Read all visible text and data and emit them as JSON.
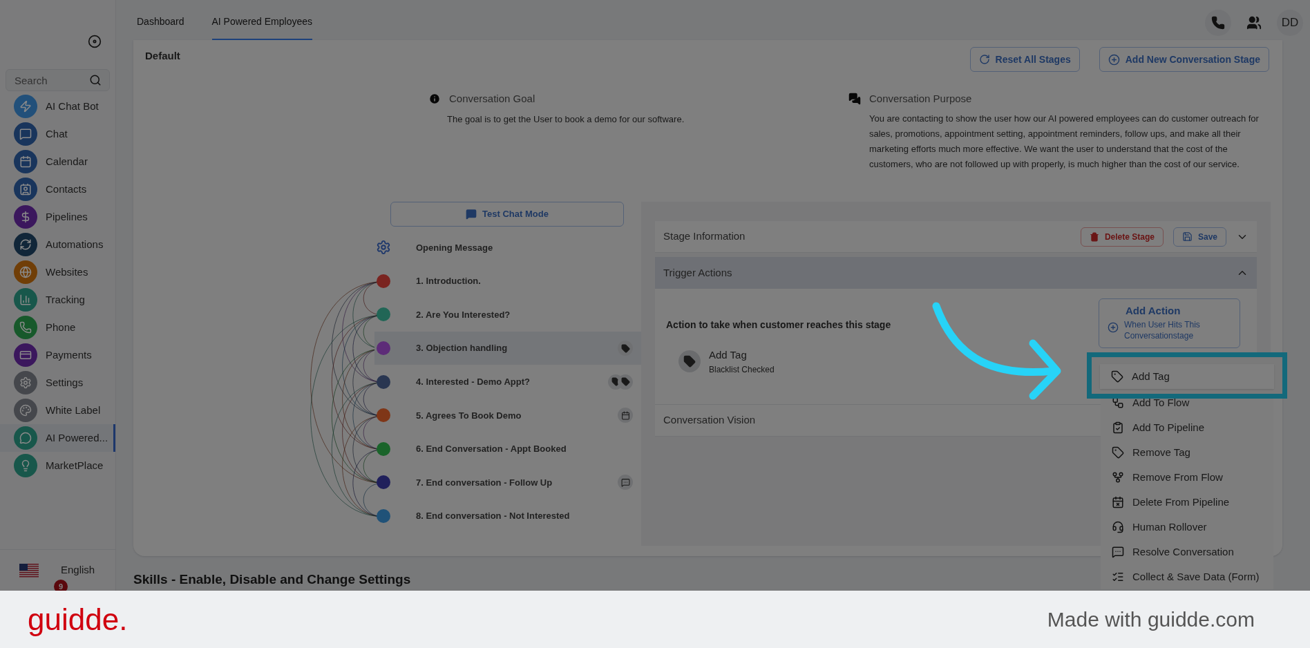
{
  "sidebar": {
    "search": {
      "placeholder": "Search"
    },
    "items": [
      {
        "label": "AI Chat Bot",
        "color": "#22507a",
        "selected": false
      },
      {
        "label": "Chat",
        "color": "#19355c",
        "selected": false
      },
      {
        "label": "Calendar",
        "color": "#19355c",
        "selected": false
      },
      {
        "label": "Contacts",
        "color": "#19355c",
        "selected": false
      },
      {
        "label": "Pipelines",
        "color": "#3b175d",
        "selected": false
      },
      {
        "label": "Automations",
        "color": "#112639",
        "selected": false
      },
      {
        "label": "Websites",
        "color": "#703e07",
        "selected": false
      },
      {
        "label": "Tracking",
        "color": "#18574b",
        "selected": false
      },
      {
        "label": "Phone",
        "color": "#17592b",
        "selected": false
      },
      {
        "label": "Payments",
        "color": "#3b175d",
        "selected": false
      },
      {
        "label": "Settings",
        "color": "#45474c",
        "selected": false
      },
      {
        "label": "White Label",
        "color": "#45474c",
        "selected": false
      },
      {
        "label": "AI Powered...",
        "color": "#18574b",
        "selected": true
      },
      {
        "label": "MarketPlace",
        "color": "#18574b",
        "selected": false
      }
    ],
    "language": "English",
    "badge": "9"
  },
  "tabs": [
    {
      "label": "Dashboard",
      "selected": false
    },
    {
      "label": "AI Powered Employees",
      "selected": true
    }
  ],
  "avatar": "DD",
  "card": {
    "title": "Default",
    "buttons": [
      "Reset All Stages",
      "Add New Conversation Stage"
    ],
    "goal": {
      "heading": "Conversation Goal",
      "text": "The goal is to get the User to book a demo for our software."
    },
    "purpose": {
      "heading": "Conversation Purpose",
      "text": "You are contacting to show the user how our AI powered employees can do customer outreach for sales, promotions, appointment setting, appointment reminders, follow ups, and make all their marketing efforts much more effective. We want the user to understand that the cost of the customers, who are not followed up with properly, is much higher than the cost of our service."
    },
    "test_button": "Test Chat Mode",
    "opening": "Opening Message",
    "stages": [
      {
        "label": "1. Introduction.",
        "color": "#7a2420",
        "selected": false
      },
      {
        "label": "2. Are You Interested?",
        "color": "#216656",
        "selected": false
      },
      {
        "label": "3. Objection handling",
        "color": "#5d2c78",
        "selected": true,
        "badges": [
          {
            "kind": "tag"
          }
        ]
      },
      {
        "label": "4. Interested - Demo Appt?",
        "color": "#293651",
        "selected": false,
        "badges": [
          {
            "kind": "tag"
          },
          {
            "kind": "tag"
          }
        ]
      },
      {
        "label": "5. Agrees To Book Demo",
        "color": "#7f3617",
        "selected": false,
        "badges": [
          {
            "kind": "calendar"
          }
        ]
      },
      {
        "label": "6. End Conversation - Appt Booked",
        "color": "#1a642a",
        "selected": false
      },
      {
        "label": "7. End conversation - Follow Up",
        "color": "#20205b",
        "selected": false,
        "badges": [
          {
            "kind": "chat"
          }
        ]
      },
      {
        "label": "8. End conversation - Not Interested",
        "color": "#205278",
        "selected": false
      }
    ],
    "sections": [
      {
        "title": "Stage Information",
        "expanded": false
      },
      {
        "title": "Trigger Actions",
        "expanded": true
      },
      {
        "title": "Conversation Vision",
        "expanded": false
      }
    ],
    "stage_buttons": [
      "Delete Stage",
      "Save"
    ],
    "trigger": {
      "heading": "Action to take when customer reaches this stage",
      "action": {
        "title": "Add Tag",
        "subtitle": "Blacklist Checked"
      },
      "add_action": {
        "title": "Add Action",
        "subtitle": "When User Hits This Conversationstage"
      }
    },
    "menu": [
      {
        "label": "Add Tag",
        "selected": true
      },
      {
        "label": "Add To Flow",
        "selected": false
      },
      {
        "label": "Add To Pipeline",
        "selected": false
      },
      {
        "label": "Remove Tag",
        "selected": false
      },
      {
        "label": "Remove From Flow",
        "selected": false
      },
      {
        "label": "Delete From Pipeline",
        "selected": false
      },
      {
        "label": "Human Rollover",
        "selected": false
      },
      {
        "label": "Resolve Conversation",
        "selected": false
      },
      {
        "label": "Collect & Save Data (Form)",
        "selected": false
      }
    ]
  },
  "skills_heading": "Skills - Enable, Disable and Change Settings",
  "footer": {
    "logo": "guidde.",
    "text": "Made with guidde.com"
  }
}
